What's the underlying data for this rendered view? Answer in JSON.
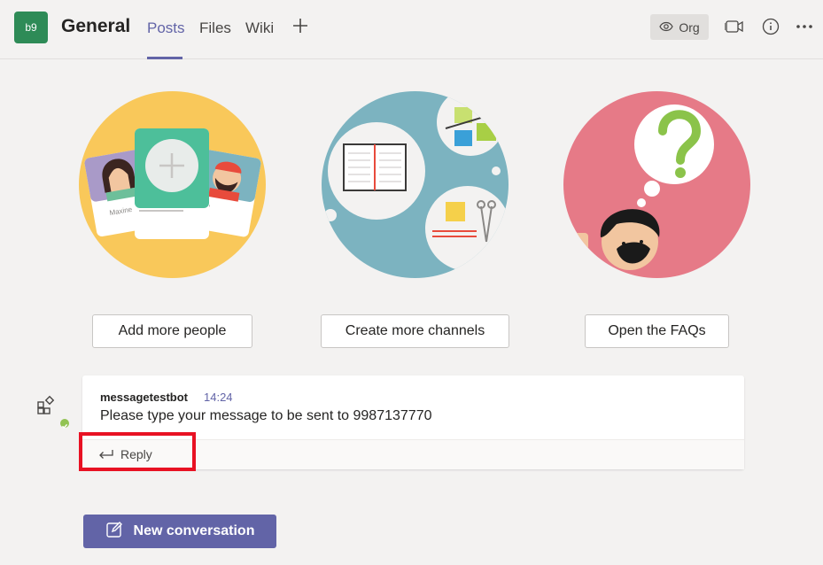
{
  "header": {
    "team_initials": "b9",
    "channel_name": "General",
    "tabs": [
      {
        "label": "Posts",
        "active": true
      },
      {
        "label": "Files",
        "active": false
      },
      {
        "label": "Wiki",
        "active": false
      }
    ],
    "org_label": "Org"
  },
  "illustrations": {
    "people_card_names": [
      "Maxine",
      "ky"
    ],
    "actions": [
      {
        "label": "Add more people"
      },
      {
        "label": "Create more channels"
      },
      {
        "label": "Open the FAQs"
      }
    ]
  },
  "message": {
    "sender": "messagetestbot",
    "time": "14:24",
    "text": "Please type your message to be sent to 9987137770",
    "reply_label": "Reply"
  },
  "new_conversation_label": "New conversation",
  "colors": {
    "accent": "#6264a7",
    "team_avatar": "#2e8b57",
    "highlight": "#e81123"
  }
}
